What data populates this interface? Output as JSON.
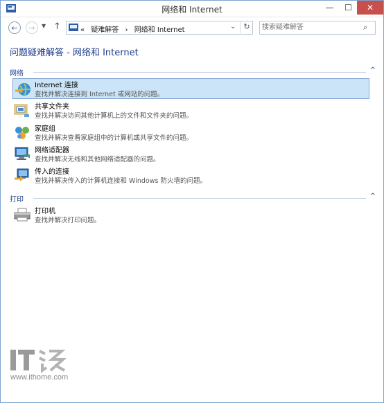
{
  "window": {
    "title": "网络和 Internet",
    "min_glyph": "—",
    "max_glyph": "☐",
    "close_glyph": "✕"
  },
  "nav": {
    "back_glyph": "←",
    "forward_glyph": "→",
    "recent_glyph": "▼",
    "up_glyph": "↑",
    "breadcrumb_prefix": "«",
    "breadcrumb": [
      "疑难解答",
      "网络和 Internet"
    ],
    "breadcrumb_sep": "›",
    "dropdown_glyph": "⌄",
    "refresh_glyph": "↻",
    "search_placeholder": "搜索疑难解答",
    "search_glyph": "⌕"
  },
  "page": {
    "heading": "问题疑难解答 - 网络和 Internet"
  },
  "groups": [
    {
      "title": "网络",
      "chevron": "^",
      "items": [
        {
          "name": "Internet 连接",
          "desc": "查找并解决连接到 Internet 或网站的问题。",
          "icon": "globe-connection-icon",
          "selected": true
        },
        {
          "name": "共享文件夹",
          "desc": "查找并解决访问其他计算机上的文件和文件夹的问题。",
          "icon": "shared-folder-icon",
          "selected": false
        },
        {
          "name": "家庭组",
          "desc": "查找并解决查看家庭组中的计算机或共享文件的问题。",
          "icon": "homegroup-icon",
          "selected": false
        },
        {
          "name": "网络适配器",
          "desc": "查找并解决无线和其他网络适配器的问题。",
          "icon": "network-adapter-icon",
          "selected": false
        },
        {
          "name": "传入的连接",
          "desc": "查找并解决传入的计算机连接和 Windows 防火墙的问题。",
          "icon": "incoming-connection-icon",
          "selected": false
        }
      ]
    },
    {
      "title": "打印",
      "chevron": "^",
      "items": [
        {
          "name": "打印机",
          "desc": "查找并解决打印问题。",
          "icon": "printer-icon",
          "selected": false
        }
      ]
    }
  ],
  "watermark": {
    "logo_text": "IT之家",
    "url": "www.ithome.com"
  },
  "colors": {
    "accent": "#1e3c8c",
    "selection": "#cce4f7",
    "close_button": "#c7504c"
  }
}
